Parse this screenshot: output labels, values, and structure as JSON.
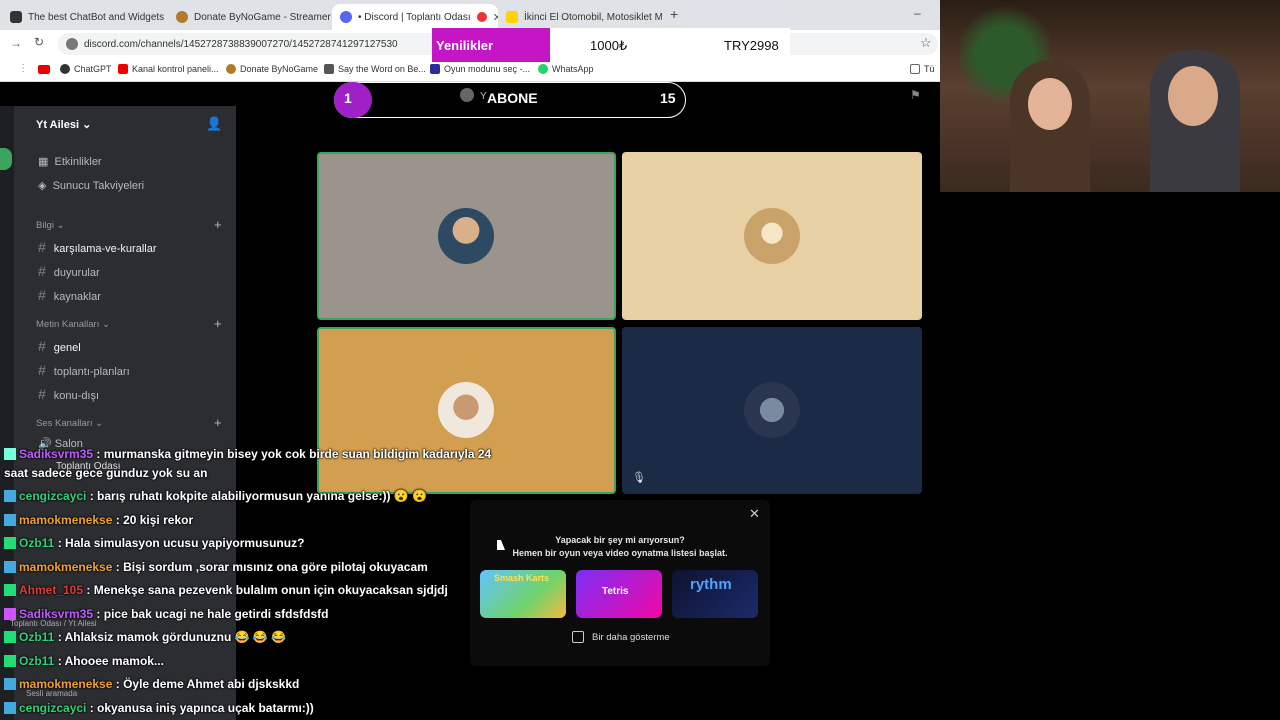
{
  "browser": {
    "tabs": [
      {
        "title": "The best ChatBot and Widgets",
        "icon": "github-icon"
      },
      {
        "title": "Donate ByNoGame - Streamer",
        "icon": "donate-icon"
      },
      {
        "title": "• Discord | Toplantı Odası",
        "icon": "discord-icon"
      },
      {
        "title": "İkinci El Otomobil, Motosiklet M",
        "icon": "sahibinden-icon"
      }
    ],
    "url": "discord.com/channels/1452728738839007270/1452728741297127530",
    "bookmarks": [
      "ChatGPT",
      "Kanal kontrol paneli...",
      "Donate ByNoGame",
      "Say the Word on Be...",
      "Oyun modunu seç -...",
      "WhatsApp",
      "Tü"
    ]
  },
  "overlay": {
    "news_label": "Yenilikler",
    "ticker_amount": "1000₺",
    "ticker_currency": "TRY2998",
    "sub_goal": {
      "current": "1",
      "label": "ABONE",
      "target": "15",
      "prefix": "Y"
    }
  },
  "discord": {
    "server_name": "Yt Ailesi",
    "top_items": [
      "Etkinlikler",
      "Sunucu Takviyeleri"
    ],
    "categories": [
      {
        "name": "Bilgi",
        "channels": [
          "karşılama-ve-kurallar",
          "duyurular",
          "kaynaklar"
        ]
      },
      {
        "name": "Metin Kanalları",
        "channels": [
          "genel",
          "toplantı-planları",
          "konu-dışı"
        ]
      },
      {
        "name": "Ses Kanalları",
        "channels": [
          "Salon",
          "Toplantı Odası"
        ]
      }
    ],
    "voice_panel": {
      "channel": "Toplantı Odası / Yt Ailesi",
      "status": "Sesli aramada"
    },
    "tile_colors": [
      "#9b948c",
      "#e8d1a5",
      "#d29e50",
      "#1b2a45"
    ],
    "popup": {
      "title": "Yapacak bir şey mi arıyorsun?",
      "subtitle": "Hemen bir oyun veya video oynatma listesi başlat.",
      "games": [
        "Smash Karts",
        "Tetris",
        "rythm"
      ],
      "dont_show_label": "Bir daha gösterme"
    }
  },
  "chat": [
    {
      "user": "Sadiksvrm35",
      "text": ": murmanska gitmeyin bisey yok cok birde suan bildigim kadarıyla 24",
      "cls": "u4"
    },
    {
      "user": "",
      "text": "saat sadece gece gunduz yok su an",
      "cls": "u"
    },
    {
      "user": "cengizcayci",
      "text": ": barış ruhatı kokpite alabiliyormusun yanına gelse:)) 😮 😮",
      "cls": "u2"
    },
    {
      "user": "mamokmenekse",
      "text": ": 20 kişi rekor",
      "cls": "u"
    },
    {
      "user": "Ozb11",
      "text": ": Hala simulasyon ucusu yapiyormusunuz?",
      "cls": "u2"
    },
    {
      "user": "mamokmenekse",
      "text": ": Bişi sordum ,sorar mısınız ona göre pilotaj okuyacam",
      "cls": "u"
    },
    {
      "user": "Ahmet_105",
      "text": ": Menekşe sana pezevenk bulalım onun için okuyacaksan sjdjdj",
      "cls": "u3"
    },
    {
      "user": "Sadiksvrm35",
      "text": ": pice bak ucagi ne hale getirdi sfdsfdsfd",
      "cls": "u4"
    },
    {
      "user": "Ozb11",
      "text": ": Ahlaksiz mamok gördunuznu 😂 😂 😂",
      "cls": "u2"
    },
    {
      "user": "Ozb11",
      "text": ": Ahooee mamok...",
      "cls": "u2"
    },
    {
      "user": "mamokmenekse",
      "text": ": Öyle deme Ahmet abi djskskkd",
      "cls": "u"
    },
    {
      "user": "cengizcayci",
      "text": ": okyanusa iniş yapınca uçak batarmı:))",
      "cls": "u2"
    }
  ]
}
